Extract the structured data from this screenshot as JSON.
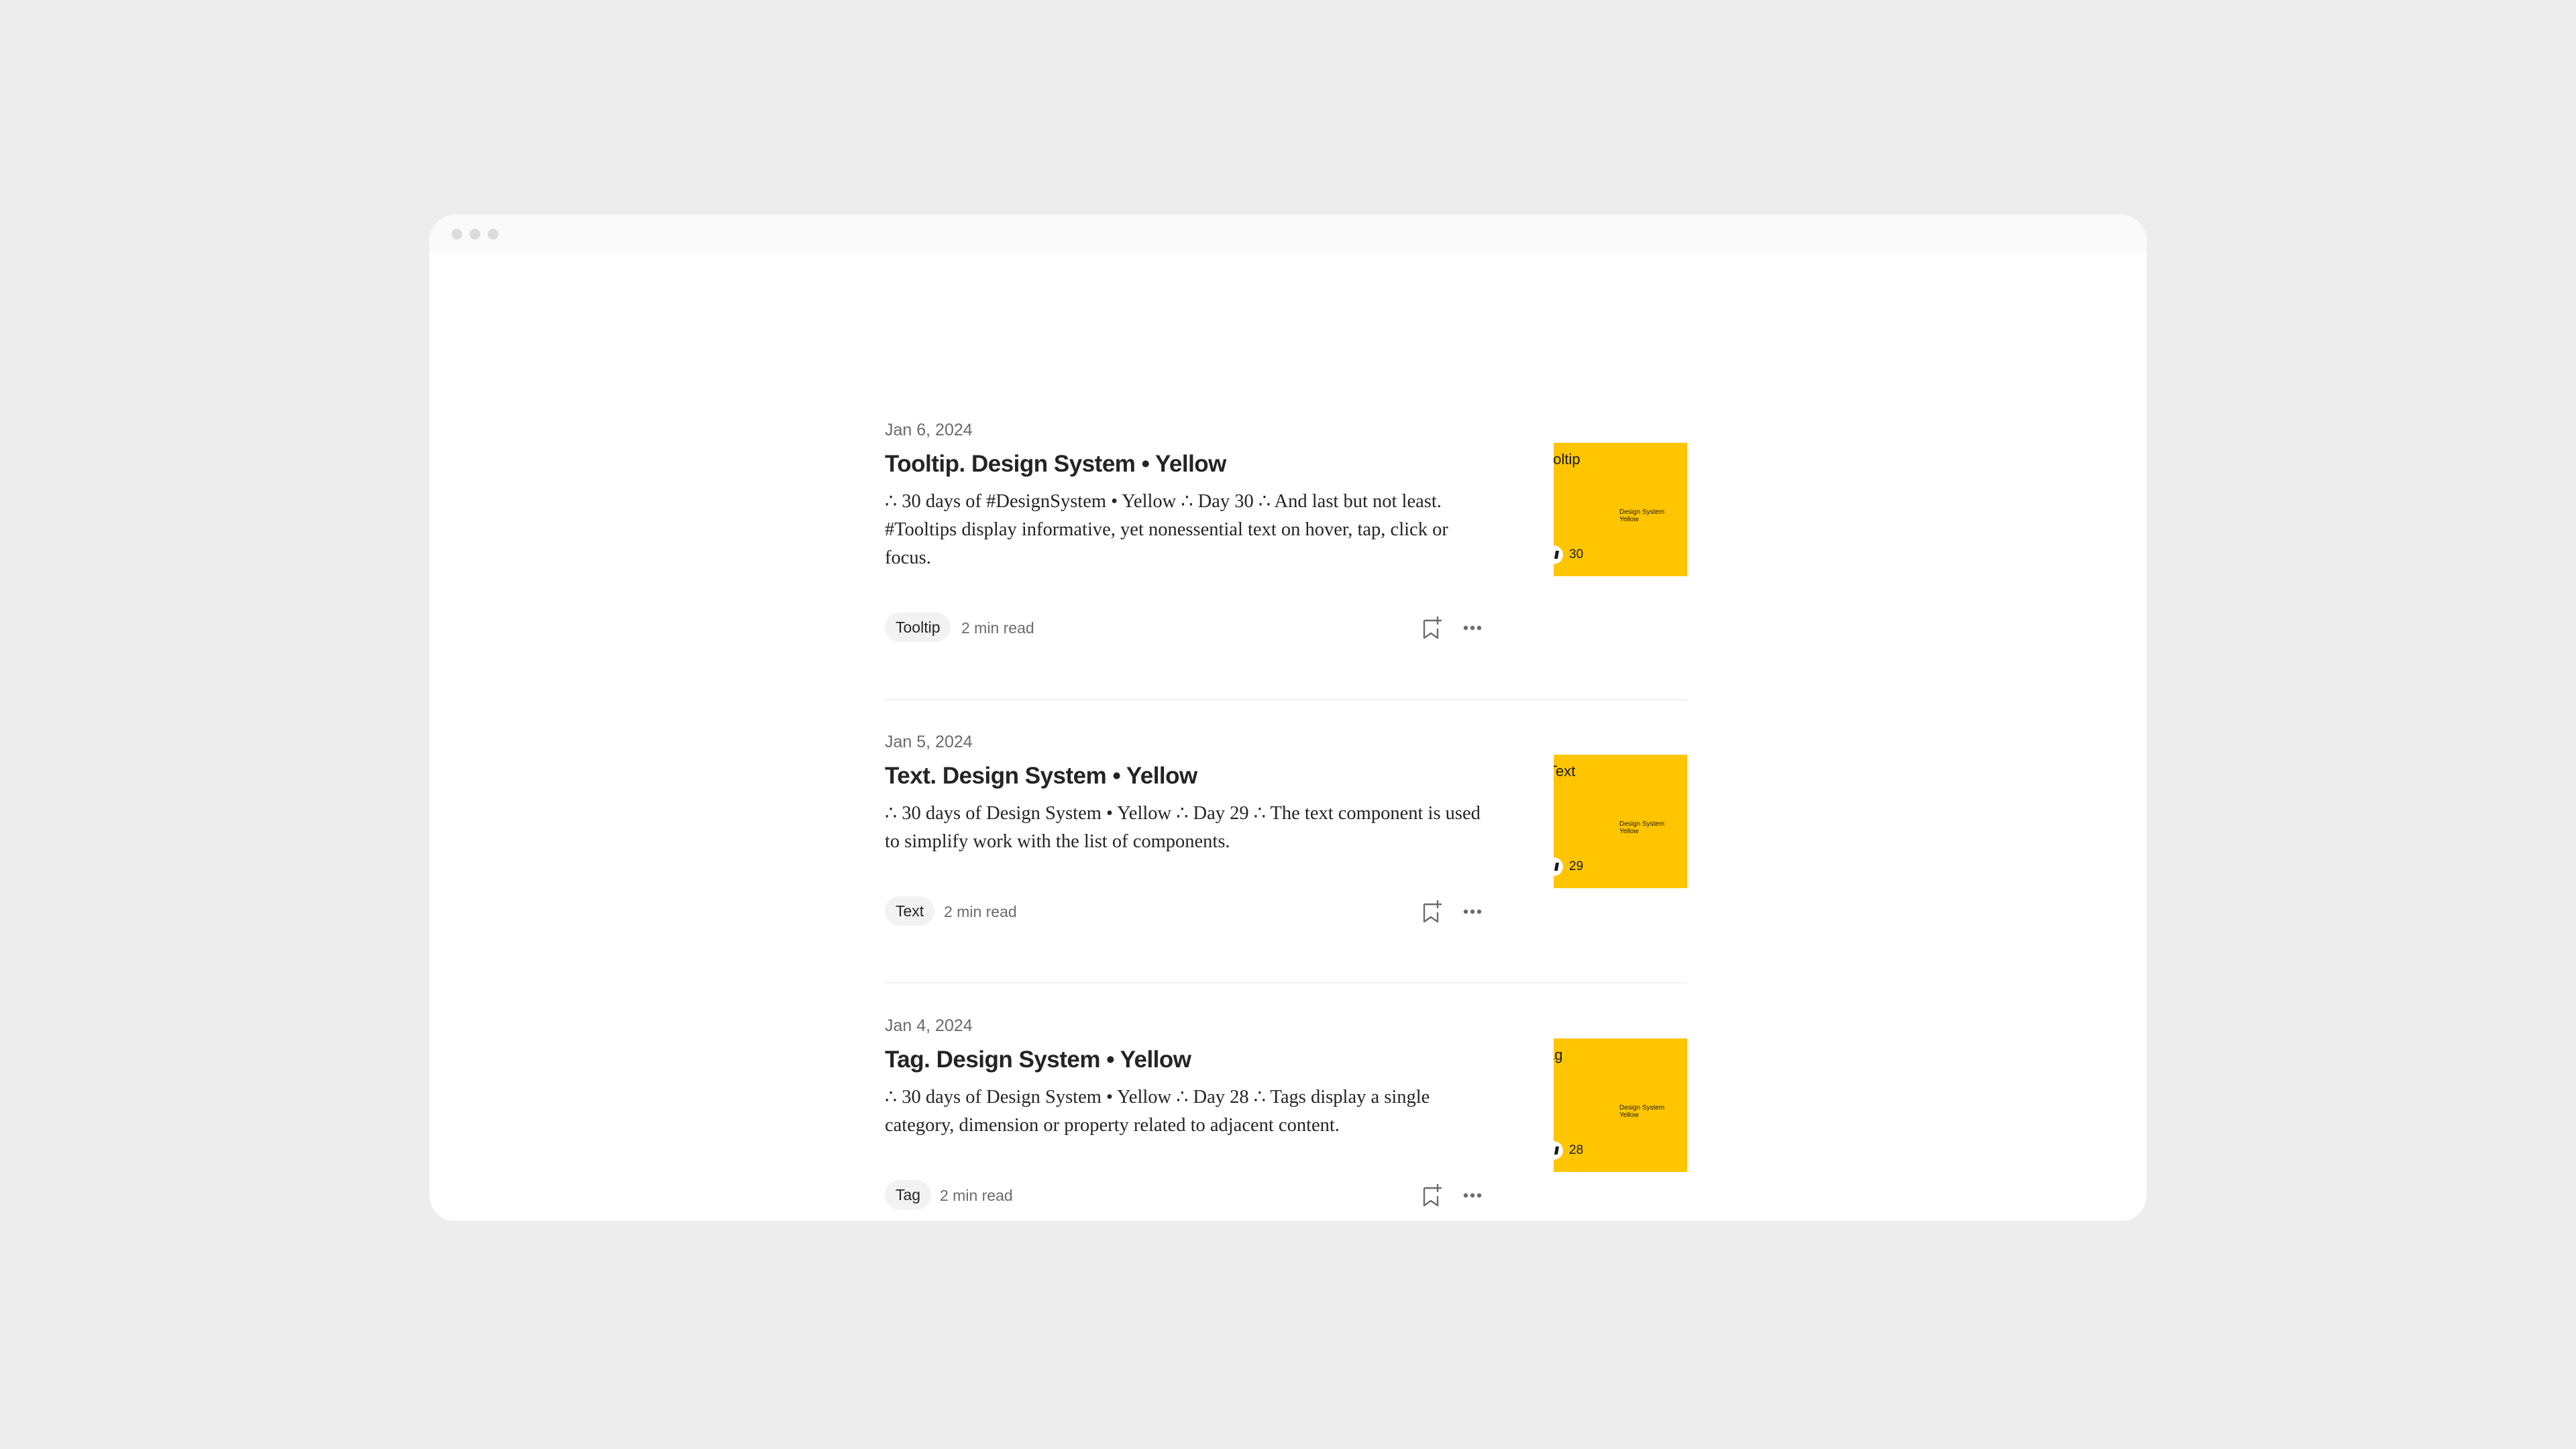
{
  "window": {
    "dots": [
      "close",
      "minimize",
      "maximize"
    ]
  },
  "articles": [
    {
      "date": "Jan 6, 2024",
      "title": "Tooltip. Design System • Yellow",
      "excerpt": "∴ 30 days of #DesignSystem • Yellow ∴ Day 30 ∴ And last but not least. #Tooltips display informative, yet nonessential text on hover, tap, click or focus.",
      "tag": "Tooltip",
      "read_time": "2 min read",
      "thumb": {
        "title": "Tooltip",
        "subtitle": "Design System\nYellow",
        "day": "30",
        "color": "#FFC500"
      }
    },
    {
      "date": "Jan 5, 2024",
      "title": "Text. Design System • Yellow",
      "excerpt": "∴ 30 days of Design System • Yellow ∴ Day 29 ∴ The text component is used to simplify work with the list of components.",
      "tag": "Text",
      "read_time": "2 min read",
      "thumb": {
        "title": "Text",
        "subtitle": "Design System\nYellow",
        "day": "29",
        "color": "#FFC500"
      }
    },
    {
      "date": "Jan 4, 2024",
      "title": "Tag. Design System • Yellow",
      "excerpt": "∴ 30 days of Design System • Yellow ∴ Day 28 ∴ Tags display a single category, dimension or property related to adjacent content.",
      "tag": "Tag",
      "read_time": "2 min read",
      "thumb": {
        "title": "Tag",
        "subtitle": "Design System\nYellow",
        "day": "28",
        "color": "#FFC500"
      }
    }
  ],
  "icons": {
    "bookmark": "bookmark-add-icon",
    "more": "more-horizontal-icon"
  }
}
